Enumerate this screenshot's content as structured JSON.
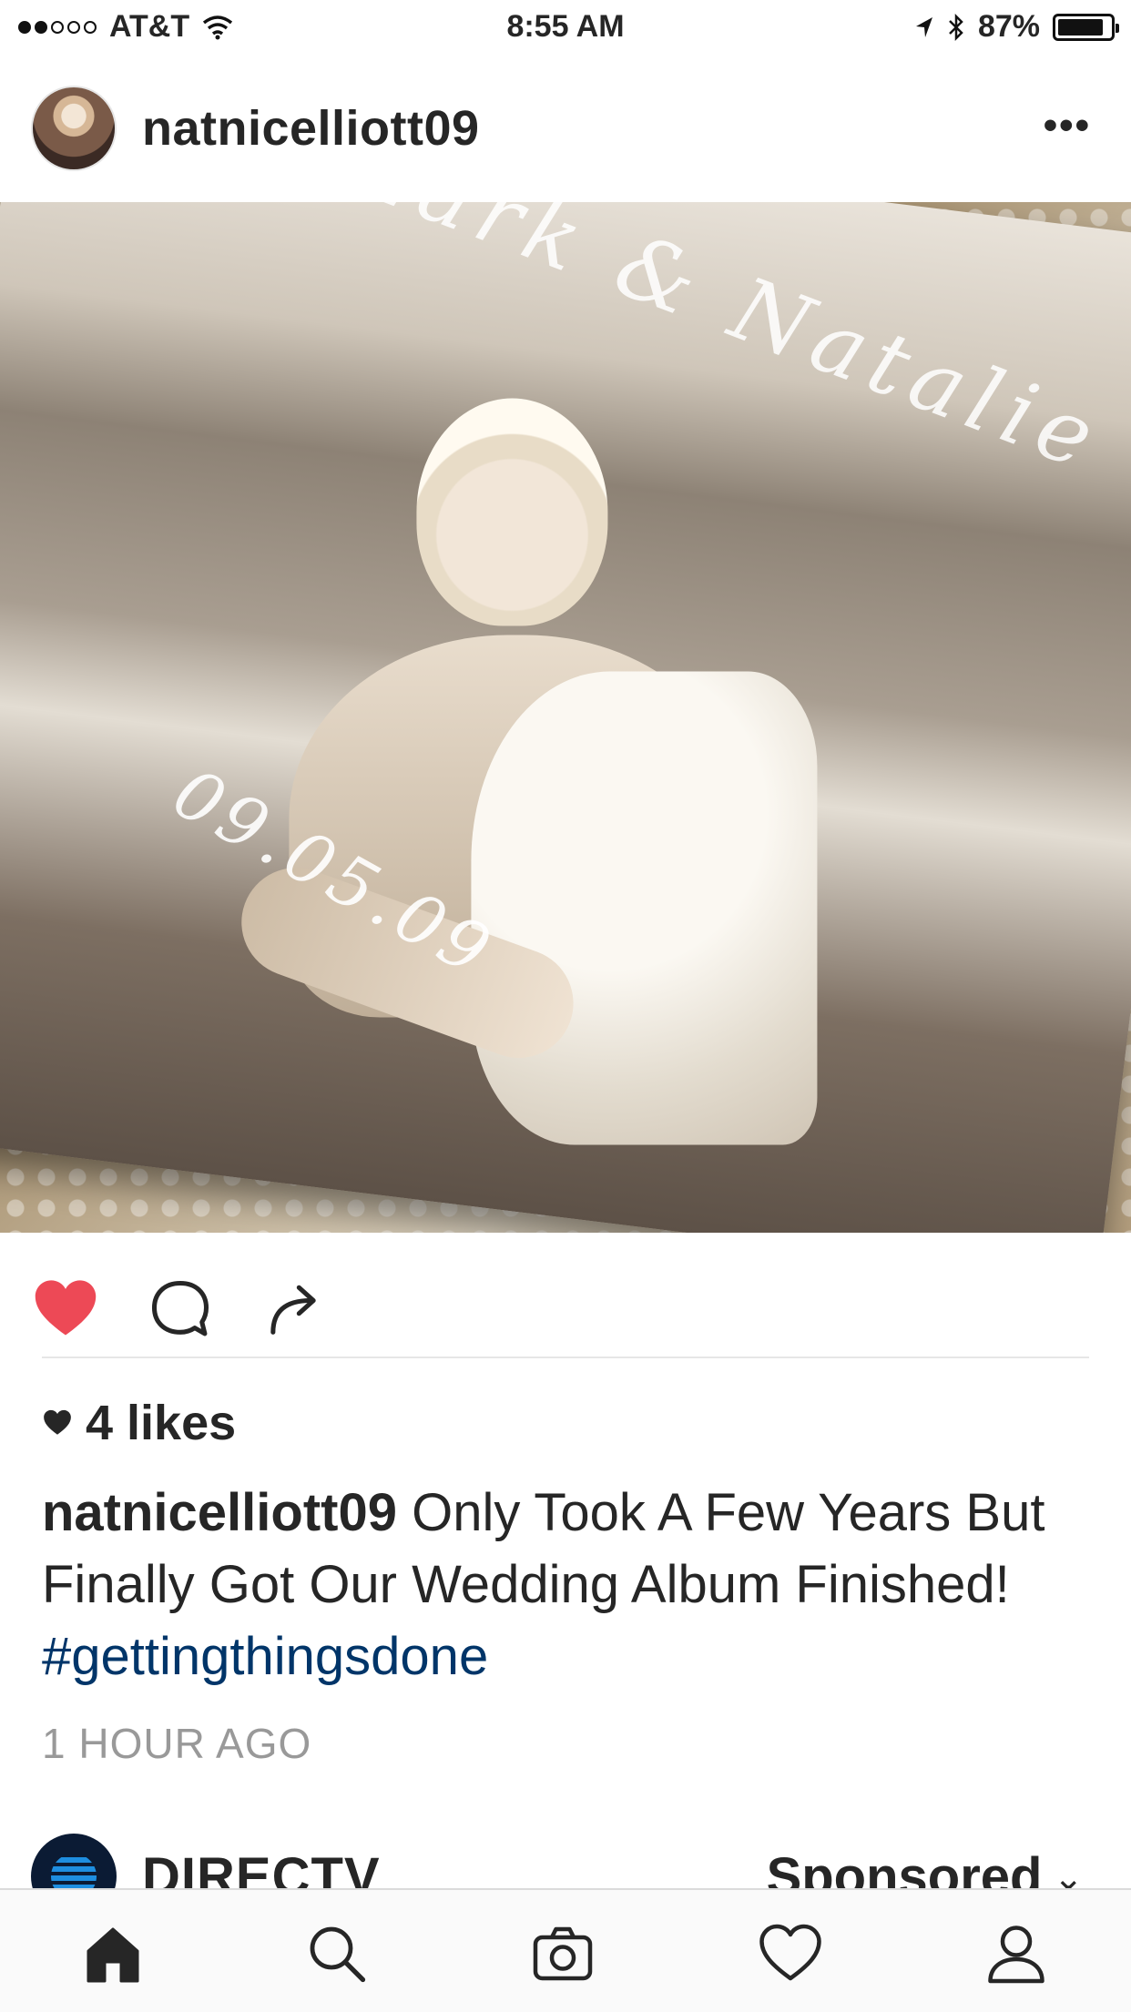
{
  "status_bar": {
    "carrier": "AT&T",
    "time": "8:55 AM",
    "battery": "87%",
    "battery_level": 0.87,
    "signal_bars_filled": 2,
    "signal_bars_total": 5
  },
  "post": {
    "username": "natnicelliott09",
    "photo_text": {
      "names": "Mark & Natalie",
      "date": "09.05.09"
    },
    "likes": "4 likes",
    "liked": true,
    "caption_user": "natnicelliott09",
    "caption_text": " Only Took A Few Years But Finally Got Our Wedding Album Finished! ",
    "hashtag": "#gettingthingsdone",
    "timestamp": "1 HOUR AGO"
  },
  "next_post": {
    "username": "DIRECTV",
    "sponsored": "Sponsored"
  },
  "colors": {
    "like_red": "#ed4956",
    "hashtag_blue": "#003569",
    "timestamp_gray": "#999999",
    "text": "#262626"
  },
  "icons": {
    "tabs": [
      "home-icon",
      "search-icon",
      "camera-icon",
      "heart-icon",
      "profile-icon"
    ],
    "actions": [
      "heart-icon",
      "comment-icon",
      "share-icon"
    ]
  }
}
